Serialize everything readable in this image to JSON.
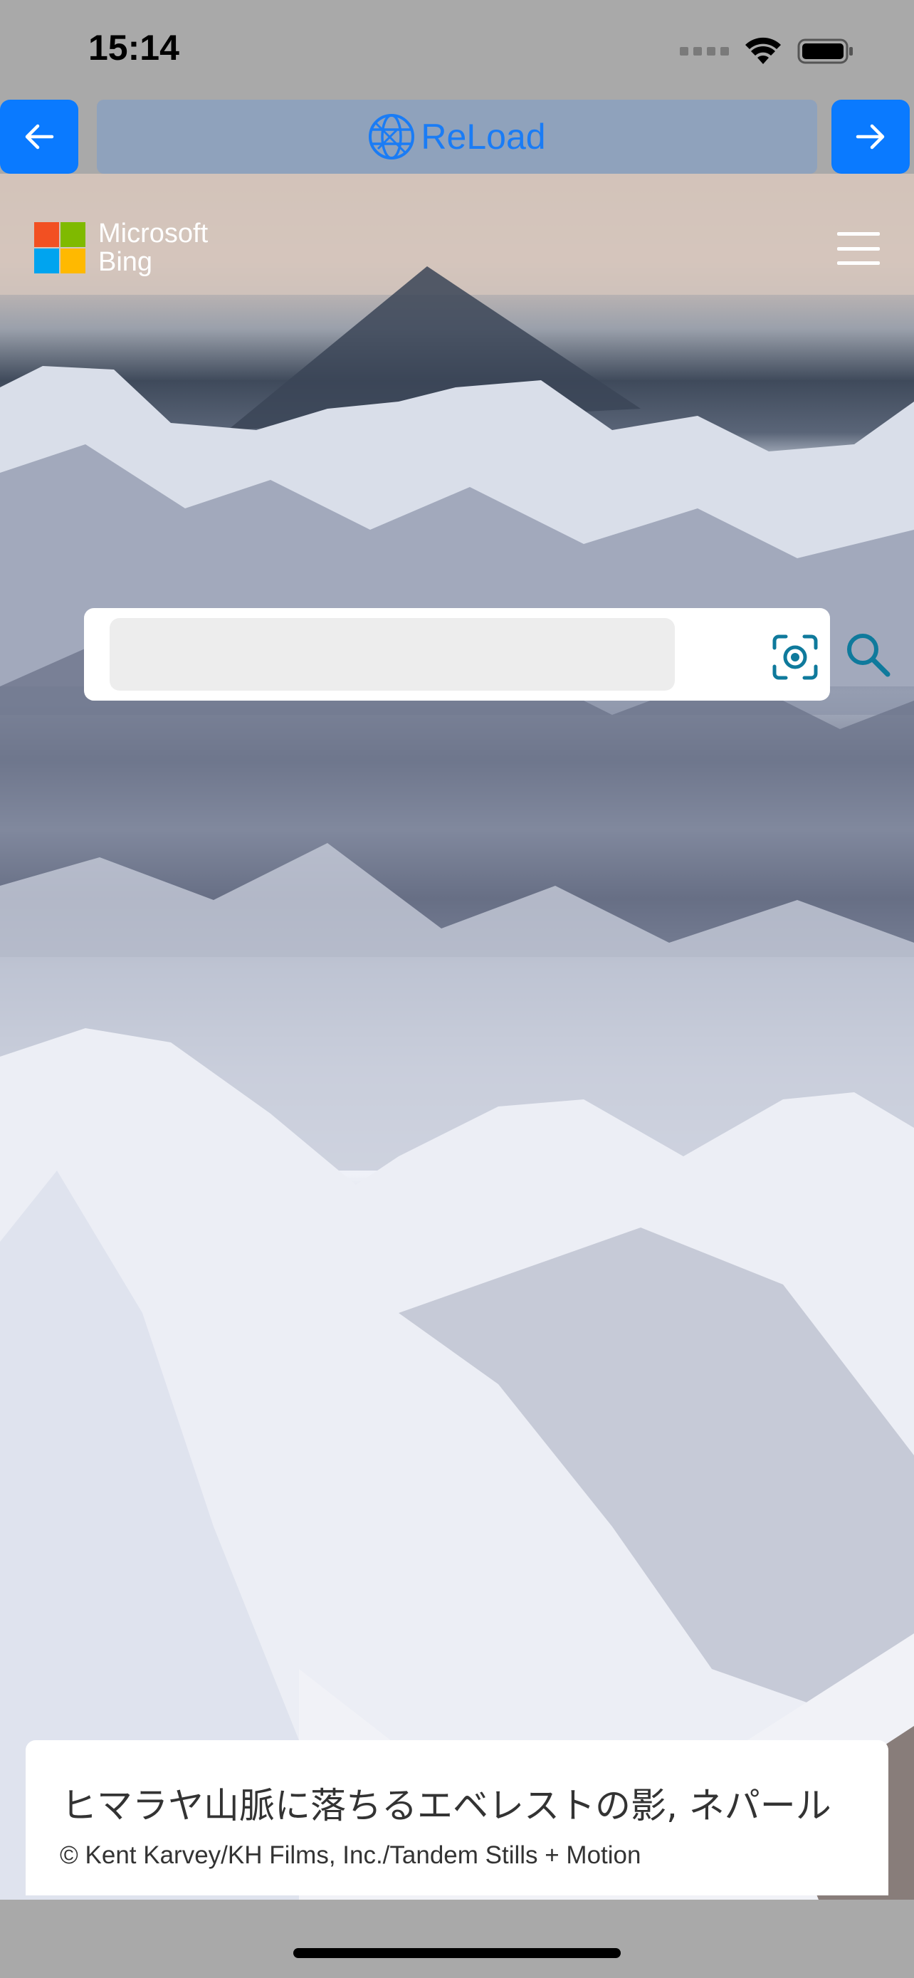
{
  "status_bar": {
    "time": "15:14",
    "wifi_icon": "wifi-icon",
    "battery_icon": "battery-icon"
  },
  "toolbar": {
    "back_icon": "arrow-left-icon",
    "forward_icon": "arrow-right-icon",
    "reload_icon": "globe-icon",
    "reload_label": "ReLoad",
    "button_color": "#0a7aff",
    "reload_bg": "#8fa2bc",
    "reload_text_color": "#1a7cf5"
  },
  "bing": {
    "logo_line1": "Microsoft",
    "logo_line2": "Bing",
    "menu_icon": "hamburger-menu-icon",
    "logo_colors": [
      "#f25022",
      "#7fba00",
      "#00a4ef",
      "#ffb900"
    ]
  },
  "search": {
    "placeholder": "",
    "value": "",
    "visual_search_icon": "visual-search-icon",
    "search_icon": "search-icon",
    "icon_color": "#0f7a9c"
  },
  "caption": {
    "title": "ヒマラヤ山脈に落ちるエベレストの影, ネパール",
    "credit": "© Kent Karvey/KH Films, Inc./Tandem Stills + Motion"
  }
}
